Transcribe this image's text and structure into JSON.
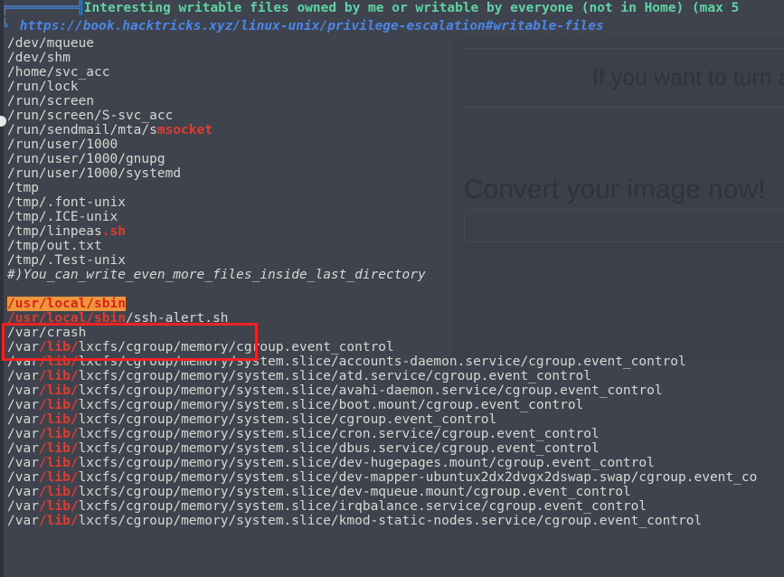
{
  "background_page": {
    "tagline": "If you want to turn a",
    "heading": "Convert your image now!",
    "input_placeholder": ""
  },
  "terminal": {
    "header": {
      "box_prefix": "╔══════════╣",
      "title": "Interesting writable files owned by me or writable by everyone (not in Home) (max 5",
      "url_prefix": "╚",
      "url": "https://book.hacktricks.xyz/linux-unix/privilege-escalation#writable-files"
    },
    "lines": [
      {
        "segments": [
          {
            "text": "/dev/mqueue",
            "style": "white"
          }
        ]
      },
      {
        "segments": [
          {
            "text": "/dev/shm",
            "style": "white"
          }
        ]
      },
      {
        "segments": [
          {
            "text": "/home/svc_acc",
            "style": "white"
          }
        ]
      },
      {
        "segments": [
          {
            "text": "/run/lock",
            "style": "white"
          }
        ]
      },
      {
        "segments": [
          {
            "text": "/run/screen",
            "style": "white"
          }
        ]
      },
      {
        "segments": [
          {
            "text": "/run/screen/S-svc_acc",
            "style": "white"
          }
        ]
      },
      {
        "segments": [
          {
            "text": "/run/sendmail/mta/s",
            "style": "white"
          },
          {
            "text": "msocket",
            "style": "red"
          }
        ]
      },
      {
        "segments": [
          {
            "text": "/run/user/1000",
            "style": "white"
          }
        ]
      },
      {
        "segments": [
          {
            "text": "/run/user/1000/gnupg",
            "style": "white"
          }
        ]
      },
      {
        "segments": [
          {
            "text": "/run/user/1000/systemd",
            "style": "white"
          }
        ]
      },
      {
        "segments": [
          {
            "text": "/tmp",
            "style": "white"
          }
        ]
      },
      {
        "segments": [
          {
            "text": "/tmp/.font-unix",
            "style": "white"
          }
        ]
      },
      {
        "segments": [
          {
            "text": "/tmp/.ICE-unix",
            "style": "white"
          }
        ]
      },
      {
        "segments": [
          {
            "text": "/tmp/linpeas",
            "style": "white"
          },
          {
            "text": ".sh",
            "style": "red"
          }
        ]
      },
      {
        "segments": [
          {
            "text": "/tmp/out.txt",
            "style": "white"
          }
        ]
      },
      {
        "segments": [
          {
            "text": "/tmp/.Test-unix",
            "style": "white"
          }
        ]
      },
      {
        "segments": [
          {
            "text": "#)You_can_write_even_more_files_inside_last_directory",
            "style": "italic-note"
          }
        ]
      },
      {
        "segments": [
          {
            "text": "",
            "style": "white"
          }
        ]
      },
      {
        "segments": [
          {
            "text": "/usr/local/sbin",
            "style": "hl"
          }
        ]
      },
      {
        "segments": [
          {
            "text": "/usr/local/sbin",
            "style": "red"
          },
          {
            "text": "/ssh-alert.sh",
            "style": "white"
          }
        ]
      },
      {
        "segments": [
          {
            "text": "/var/crash",
            "style": "white"
          }
        ]
      },
      {
        "segments": [
          {
            "text": "/var",
            "style": "white"
          },
          {
            "text": "/lib/",
            "style": "red"
          },
          {
            "text": "lxcfs/cgroup/memory/cgroup.event_control",
            "style": "white"
          }
        ]
      },
      {
        "segments": [
          {
            "text": "/var",
            "style": "white"
          },
          {
            "text": "/lib/",
            "style": "red"
          },
          {
            "text": "lxcfs/cgroup/memory/system.slice/accounts-daemon.service/cgroup.event_control",
            "style": "white"
          }
        ]
      },
      {
        "segments": [
          {
            "text": "/var",
            "style": "white"
          },
          {
            "text": "/lib/",
            "style": "red"
          },
          {
            "text": "lxcfs/cgroup/memory/system.slice/atd.service/cgroup.event_control",
            "style": "white"
          }
        ]
      },
      {
        "segments": [
          {
            "text": "/var",
            "style": "white"
          },
          {
            "text": "/lib/",
            "style": "red"
          },
          {
            "text": "lxcfs/cgroup/memory/system.slice/avahi-daemon.service/cgroup.event_control",
            "style": "white"
          }
        ]
      },
      {
        "segments": [
          {
            "text": "/var",
            "style": "white"
          },
          {
            "text": "/lib/",
            "style": "red"
          },
          {
            "text": "lxcfs/cgroup/memory/system.slice/boot.mount/cgroup.event_control",
            "style": "white"
          }
        ]
      },
      {
        "segments": [
          {
            "text": "/var",
            "style": "white"
          },
          {
            "text": "/lib/",
            "style": "red"
          },
          {
            "text": "lxcfs/cgroup/memory/system.slice/cgroup.event_control",
            "style": "white"
          }
        ]
      },
      {
        "segments": [
          {
            "text": "/var",
            "style": "white"
          },
          {
            "text": "/lib/",
            "style": "red"
          },
          {
            "text": "lxcfs/cgroup/memory/system.slice/cron.service/cgroup.event_control",
            "style": "white"
          }
        ]
      },
      {
        "segments": [
          {
            "text": "/var",
            "style": "white"
          },
          {
            "text": "/lib/",
            "style": "red"
          },
          {
            "text": "lxcfs/cgroup/memory/system.slice/dbus.service/cgroup.event_control",
            "style": "white"
          }
        ]
      },
      {
        "segments": [
          {
            "text": "/var",
            "style": "white"
          },
          {
            "text": "/lib/",
            "style": "red"
          },
          {
            "text": "lxcfs/cgroup/memory/system.slice/dev-hugepages.mount/cgroup.event_control",
            "style": "white"
          }
        ]
      },
      {
        "segments": [
          {
            "text": "/var",
            "style": "white"
          },
          {
            "text": "/lib/",
            "style": "red"
          },
          {
            "text": "lxcfs/cgroup/memory/system.slice/dev-mapper-ubuntux2dx2dvgx2dswap.swap/cgroup.event_co",
            "style": "white"
          }
        ]
      },
      {
        "segments": [
          {
            "text": "/var",
            "style": "white"
          },
          {
            "text": "/lib/",
            "style": "red"
          },
          {
            "text": "lxcfs/cgroup/memory/system.slice/dev-mqueue.mount/cgroup.event_control",
            "style": "white"
          }
        ]
      },
      {
        "segments": [
          {
            "text": "/var",
            "style": "white"
          },
          {
            "text": "/lib/",
            "style": "red"
          },
          {
            "text": "lxcfs/cgroup/memory/system.slice/irqbalance.service/cgroup.event_control",
            "style": "white"
          }
        ]
      },
      {
        "segments": [
          {
            "text": "/var",
            "style": "white"
          },
          {
            "text": "/lib/",
            "style": "red"
          },
          {
            "text": "lxcfs/cgroup/memory/system.slice/kmod-static-nodes.service/cgroup.event_control",
            "style": "white"
          }
        ]
      }
    ]
  }
}
